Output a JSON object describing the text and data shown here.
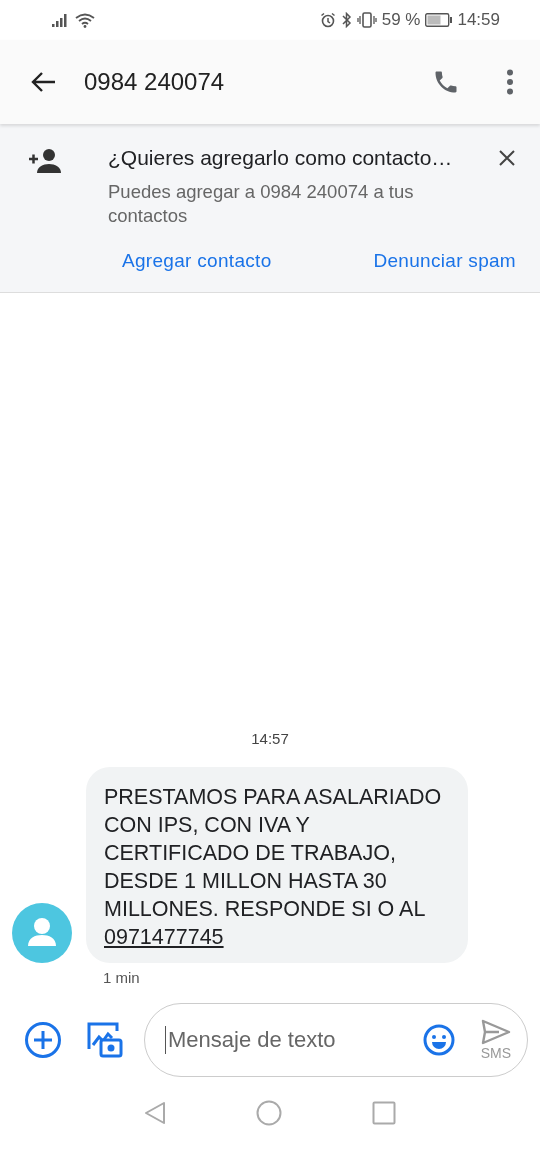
{
  "status_bar": {
    "battery": "59 %",
    "time": "14:59"
  },
  "app_bar": {
    "title": "0984 240074"
  },
  "contact_banner": {
    "title": "¿Quieres agregarlo como contacto…",
    "text": "Puedes agregar a 0984 240074 a tus contactos",
    "actions": [
      "Agregar contacto",
      "Denunciar spam"
    ]
  },
  "conversation": {
    "timestamp": "14:57",
    "messages": [
      {
        "text": "PRESTAMOS PARA ASALARIADO CON IPS, CON IVA Y CERTIFICADO DE TRABAJO, DESDE 1 MILLON HASTA 30 MILLONES. RESPONDE SI O AL",
        "link": "0971477745",
        "time": "1 min"
      }
    ]
  },
  "composer": {
    "placeholder": "Mensaje de texto",
    "send_label": "SMS"
  }
}
